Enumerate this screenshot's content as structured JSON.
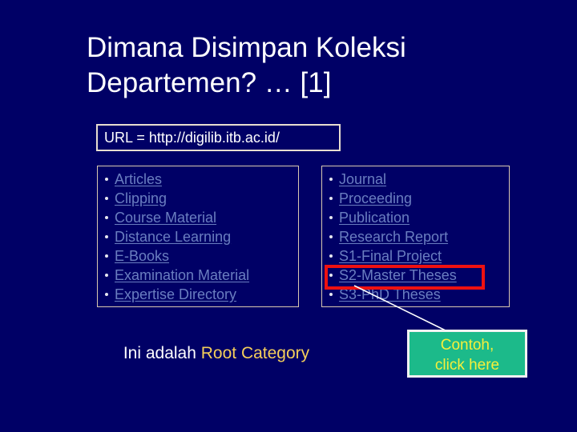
{
  "slide": {
    "background_color": "#000066",
    "title": "Dimana Disimpan Koleksi\nDepartemen? … [1]",
    "title_color": "#ffffff"
  },
  "url_banner": {
    "text": "URL = http://digilib.itb.ac.id/",
    "border_color": "#e8ded0",
    "text_color": "#ffffff"
  },
  "category_lists": {
    "link_color": "#6a7ec0",
    "border_color": "#d9c9b0",
    "left_column": [
      {
        "label": "Articles"
      },
      {
        "label": "Clipping"
      },
      {
        "label": "Course Material"
      },
      {
        "label": "Distance Learning"
      },
      {
        "label": "E-Books"
      },
      {
        "label": "Examination Material"
      },
      {
        "label": "Expertise Directory"
      }
    ],
    "right_column": [
      {
        "label": "Journal"
      },
      {
        "label": "Proceeding"
      },
      {
        "label": "Publication"
      },
      {
        "label": "Research Report"
      },
      {
        "label": "S1-Final Project"
      },
      {
        "label": "S2-Master Theses"
      },
      {
        "label": "S3-PhD Theses"
      }
    ]
  },
  "highlight": {
    "target_label": "S2-Master Theses",
    "color": "#ee1111"
  },
  "connector": {
    "color": "#ffffff"
  },
  "root_caption": {
    "prefix": "Ini adalah ",
    "emphasis": "Root Category",
    "prefix_color": "#ffffff",
    "emphasis_color": "#f5cf5a"
  },
  "callout": {
    "line1": "Contoh,",
    "line2": "click here",
    "background_color": "#1cba8a",
    "border_color": "#f2f2f2",
    "text_color": "#f7ef3a"
  }
}
